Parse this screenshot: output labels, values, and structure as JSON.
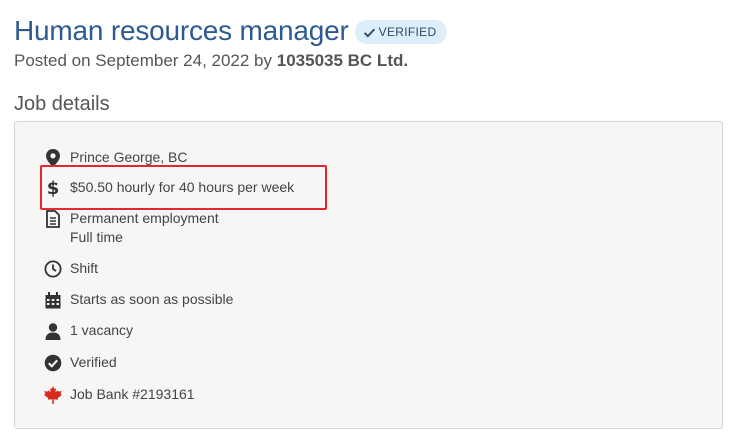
{
  "header": {
    "title": "Human resources manager",
    "verified_badge": "VERIFIED",
    "posted_prefix": "Posted on September 24, 2022 by",
    "employer": "1035035 BC Ltd."
  },
  "section": {
    "heading": "Job details"
  },
  "details": {
    "location": "Prince George, BC",
    "salary": "$50.50 hourly for 40 hours per week",
    "employment_type": "Permanent employment",
    "employment_schedule": "Full time",
    "shift": "Shift",
    "start": "Starts as soon as possible",
    "vacancy": "1 vacancy",
    "verified": "Verified",
    "job_bank": "Job Bank #2193161"
  },
  "colors": {
    "title": "#2d5b91",
    "badge_bg": "#dceefa",
    "highlight": "#e4262d",
    "maple_leaf": "#d52b1e"
  },
  "icons": [
    "checkmark-icon",
    "map-pin-icon",
    "dollar-icon",
    "document-icon",
    "clock-icon",
    "calendar-icon",
    "person-icon",
    "check-circle-icon",
    "maple-leaf-icon"
  ]
}
